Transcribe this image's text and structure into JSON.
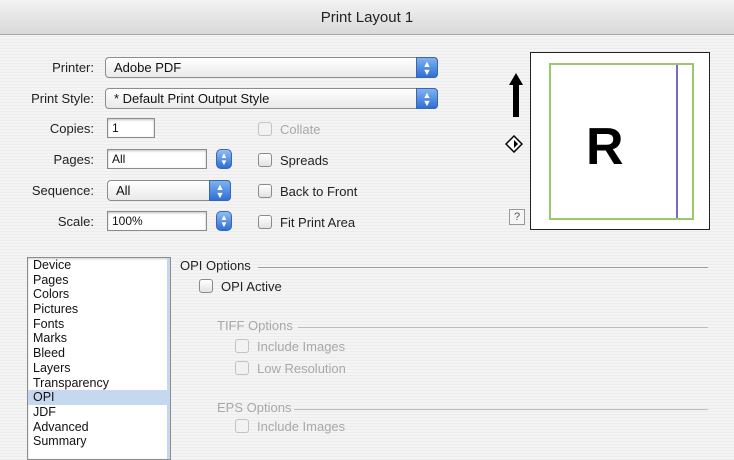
{
  "window": {
    "title": "Print Layout 1"
  },
  "printer": {
    "label": "Printer:",
    "value": "Adobe PDF"
  },
  "print_style": {
    "label": "Print Style:",
    "value": "* Default Print Output Style"
  },
  "copies": {
    "label": "Copies:",
    "value": "1"
  },
  "pages": {
    "label": "Pages:",
    "value": "All"
  },
  "sequence": {
    "label": "Sequence:",
    "value": "All"
  },
  "scale": {
    "label": "Scale:",
    "value": "100%"
  },
  "options": {
    "collate": {
      "label": "Collate",
      "checked": false,
      "enabled": false
    },
    "spreads": {
      "label": "Spreads",
      "checked": false,
      "enabled": true
    },
    "back_to_front": {
      "label": "Back to Front",
      "checked": false,
      "enabled": true
    },
    "fit_print_area": {
      "label": "Fit Print Area",
      "checked": false,
      "enabled": true
    }
  },
  "preview": {
    "letter": "R",
    "help_label": "?"
  },
  "sidebar": {
    "items": [
      "Device",
      "Pages",
      "Colors",
      "Pictures",
      "Fonts",
      "Marks",
      "Bleed",
      "Layers",
      "Transparency",
      "OPI",
      "JDF",
      "Advanced",
      "Summary"
    ],
    "selected": "OPI"
  },
  "opi": {
    "section_title": "OPI Options",
    "active_label": "OPI Active",
    "tiff_title": "TIFF Options",
    "tiff_include_images": "Include Images",
    "tiff_low_resolution": "Low Resolution",
    "eps_title": "EPS Options",
    "eps_include_images": "Include Images"
  },
  "colors": {
    "accent": "#2f6fd6",
    "selection": "#c6d7f0",
    "margin_green": "#9bc86a",
    "margin_purple": "#7a6bbf"
  }
}
